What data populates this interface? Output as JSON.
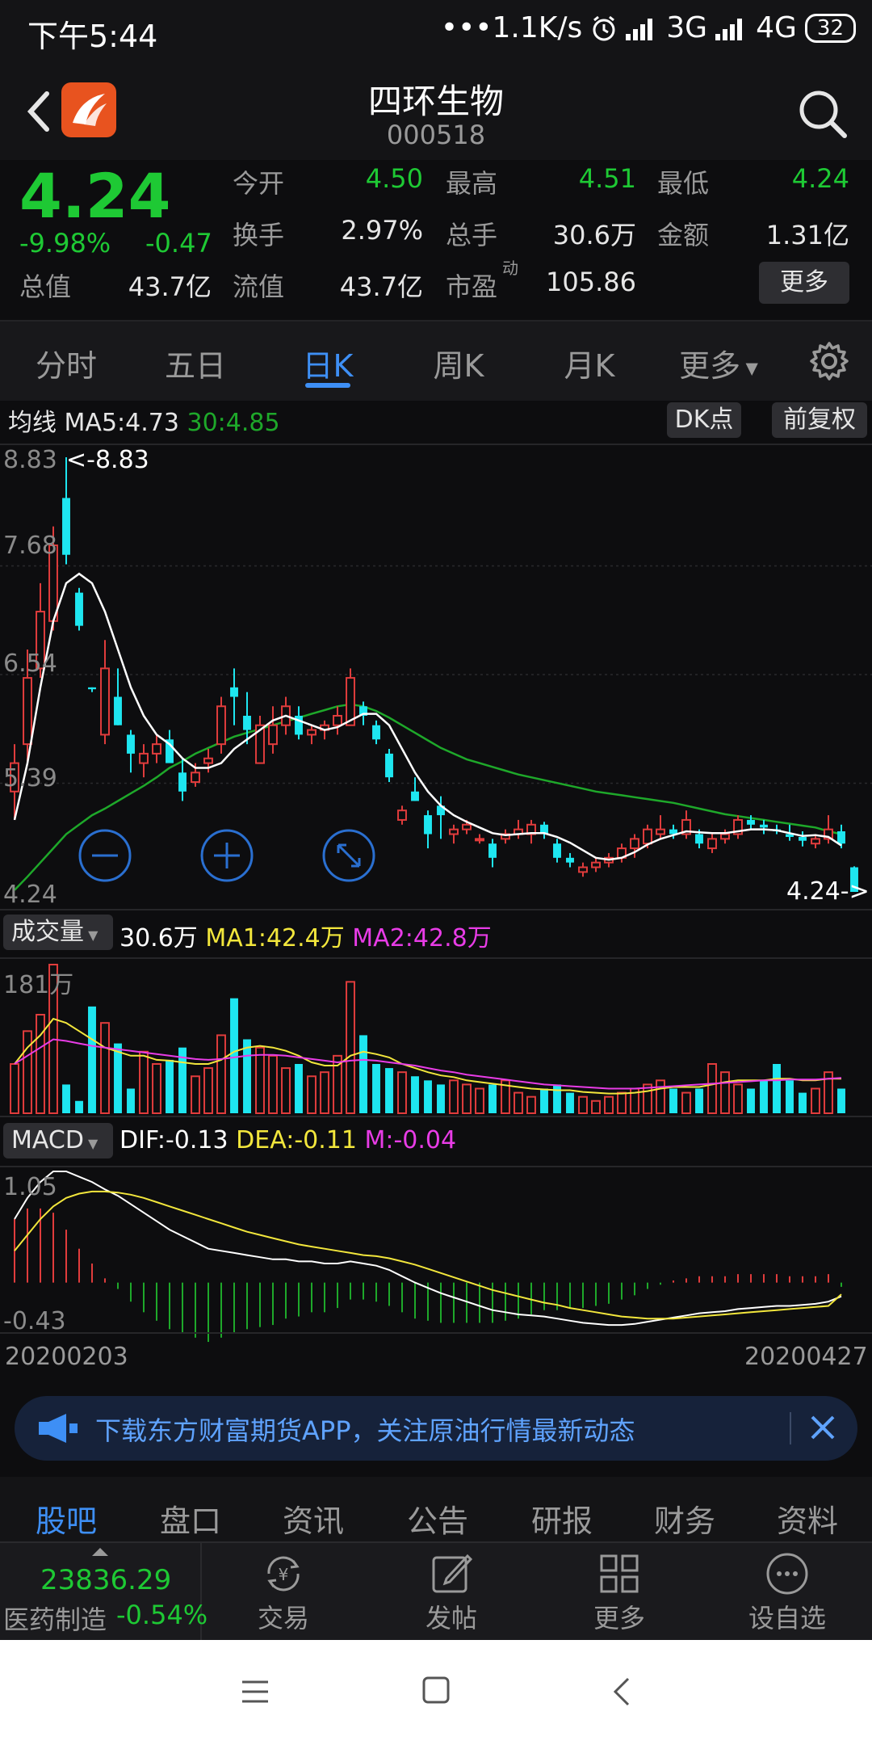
{
  "status": {
    "time": "下午5:44",
    "speed": "•••1.1K/s",
    "net1": "3G",
    "net2": "4G",
    "battery": "32"
  },
  "header": {
    "title": "四环生物",
    "code": "000518"
  },
  "quote": {
    "price": "4.24",
    "pct": "-9.98%",
    "change": "-0.47",
    "rows": [
      [
        {
          "label": "今开",
          "value": "4.50",
          "color": "#1ec934"
        },
        {
          "label": "最高",
          "value": "4.51",
          "color": "#1ec934"
        },
        {
          "label": "最低",
          "value": "4.24",
          "color": "#1ec934"
        }
      ],
      [
        {
          "label": "换手",
          "value": "2.97%",
          "color": "#e6e6e6"
        },
        {
          "label": "总手",
          "value": "30.6万",
          "color": "#e6e6e6"
        },
        {
          "label": "金额",
          "value": "1.31亿",
          "color": "#e6e6e6"
        }
      ]
    ],
    "total_label": "总值",
    "total_value": "43.7亿",
    "float_label": "流值",
    "float_value": "43.7亿",
    "pe_label": "市盈",
    "pe_sup": "动",
    "pe_value": "105.86",
    "more": "更多"
  },
  "tabs": {
    "items": [
      "分时",
      "五日",
      "日K",
      "周K",
      "月K",
      "更多"
    ],
    "active": 2
  },
  "chart": {
    "ma_label": "均线",
    "ma5": "MA5:4.73",
    "ma30": "30:4.85",
    "dk_button": "DK点",
    "adjust_button": "前复权",
    "price_axis": [
      "8.83",
      "7.68",
      "6.54",
      "5.39",
      "4.24"
    ],
    "high_marker": "<-8.83",
    "last_marker": "4.24->",
    "volume_selector": "成交量",
    "volume_value": "30.6万",
    "vol_ma1": "MA1:42.4万",
    "vol_ma2": "MA2:42.8万",
    "volume_max": "181万",
    "macd_selector": "MACD",
    "dif": "DIF:-0.13",
    "dea": "DEA:-0.11",
    "m": "M:-0.04",
    "macd_max": "1.05",
    "macd_min": "-0.43",
    "date_start": "20200203",
    "date_end": "20200427",
    "colors": {
      "up": "#e03c3c",
      "down": "#1ee6f0",
      "ma5": "#ffffff",
      "ma30": "#1ea82a",
      "ma1": "#f2e63c",
      "ma2": "#e83ce6"
    }
  },
  "chart_data": {
    "type": "candlestick",
    "y_range": [
      4.24,
      8.83
    ],
    "candles": [
      {
        "o": 5.3,
        "h": 5.8,
        "l": 5.0,
        "c": 5.6
      },
      {
        "o": 5.8,
        "h": 6.8,
        "l": 5.6,
        "c": 6.5
      },
      {
        "o": 6.6,
        "h": 7.5,
        "l": 6.5,
        "c": 7.2
      },
      {
        "o": 7.1,
        "h": 8.1,
        "l": 7.0,
        "c": 7.9
      },
      {
        "o": 8.4,
        "h": 8.83,
        "l": 7.7,
        "c": 7.8
      },
      {
        "o": 7.4,
        "h": 7.45,
        "l": 7.0,
        "c": 7.05
      },
      {
        "o": 6.4,
        "h": 6.4,
        "l": 6.35,
        "c": 6.38
      },
      {
        "o": 5.9,
        "h": 6.9,
        "l": 5.8,
        "c": 6.6
      },
      {
        "o": 6.3,
        "h": 6.6,
        "l": 6.0,
        "c": 6.0
      },
      {
        "o": 5.9,
        "h": 5.95,
        "l": 5.5,
        "c": 5.7
      },
      {
        "o": 5.6,
        "h": 5.8,
        "l": 5.45,
        "c": 5.7
      },
      {
        "o": 5.7,
        "h": 5.9,
        "l": 5.6,
        "c": 5.8
      },
      {
        "o": 5.85,
        "h": 5.95,
        "l": 5.7,
        "c": 5.6
      },
      {
        "o": 5.5,
        "h": 5.65,
        "l": 5.2,
        "c": 5.3
      },
      {
        "o": 5.4,
        "h": 5.6,
        "l": 5.35,
        "c": 5.5
      },
      {
        "o": 5.6,
        "h": 5.75,
        "l": 5.5,
        "c": 5.65
      },
      {
        "o": 5.8,
        "h": 6.3,
        "l": 5.7,
        "c": 6.2
      },
      {
        "o": 6.4,
        "h": 6.6,
        "l": 6.0,
        "c": 6.3
      },
      {
        "o": 6.1,
        "h": 6.35,
        "l": 5.8,
        "c": 5.95
      },
      {
        "o": 5.6,
        "h": 6.1,
        "l": 5.6,
        "c": 6.0
      },
      {
        "o": 5.8,
        "h": 6.2,
        "l": 5.7,
        "c": 6.0
      },
      {
        "o": 6.0,
        "h": 6.3,
        "l": 5.9,
        "c": 6.2
      },
      {
        "o": 6.1,
        "h": 6.2,
        "l": 5.85,
        "c": 5.9
      },
      {
        "o": 5.9,
        "h": 6.0,
        "l": 5.8,
        "c": 5.95
      },
      {
        "o": 5.95,
        "h": 6.05,
        "l": 5.85,
        "c": 6.0
      },
      {
        "o": 6.0,
        "h": 6.2,
        "l": 5.9,
        "c": 6.1
      },
      {
        "o": 6.0,
        "h": 6.6,
        "l": 6.0,
        "c": 6.5
      },
      {
        "o": 6.2,
        "h": 6.25,
        "l": 6.0,
        "c": 6.1
      },
      {
        "o": 6.0,
        "h": 6.05,
        "l": 5.8,
        "c": 5.85
      },
      {
        "o": 5.7,
        "h": 5.75,
        "l": 5.4,
        "c": 5.45
      },
      {
        "o": 5.0,
        "h": 5.15,
        "l": 4.95,
        "c": 5.1
      },
      {
        "o": 5.3,
        "h": 5.45,
        "l": 5.2,
        "c": 5.2
      },
      {
        "o": 5.05,
        "h": 5.1,
        "l": 4.7,
        "c": 4.85
      },
      {
        "o": 5.15,
        "h": 5.25,
        "l": 4.8,
        "c": 5.05
      },
      {
        "o": 4.85,
        "h": 4.95,
        "l": 4.75,
        "c": 4.9
      },
      {
        "o": 4.9,
        "h": 5.0,
        "l": 4.85,
        "c": 4.95
      },
      {
        "o": 4.8,
        "h": 4.85,
        "l": 4.75,
        "c": 4.8
      },
      {
        "o": 4.75,
        "h": 4.8,
        "l": 4.5,
        "c": 4.6
      },
      {
        "o": 4.8,
        "h": 4.9,
        "l": 4.75,
        "c": 4.85
      },
      {
        "o": 4.85,
        "h": 5.0,
        "l": 4.8,
        "c": 4.9
      },
      {
        "o": 4.85,
        "h": 5.0,
        "l": 4.75,
        "c": 4.95
      },
      {
        "o": 4.95,
        "h": 4.98,
        "l": 4.8,
        "c": 4.85
      },
      {
        "o": 4.75,
        "h": 4.8,
        "l": 4.55,
        "c": 4.6
      },
      {
        "o": 4.6,
        "h": 4.65,
        "l": 4.5,
        "c": 4.55
      },
      {
        "o": 4.45,
        "h": 4.55,
        "l": 4.4,
        "c": 4.5
      },
      {
        "o": 4.5,
        "h": 4.6,
        "l": 4.45,
        "c": 4.55
      },
      {
        "o": 4.55,
        "h": 4.65,
        "l": 4.5,
        "c": 4.6
      },
      {
        "o": 4.6,
        "h": 4.75,
        "l": 4.55,
        "c": 4.7
      },
      {
        "o": 4.7,
        "h": 4.85,
        "l": 4.6,
        "c": 4.8
      },
      {
        "o": 4.75,
        "h": 4.95,
        "l": 4.7,
        "c": 4.9
      },
      {
        "o": 4.85,
        "h": 5.05,
        "l": 4.8,
        "c": 4.9
      },
      {
        "o": 4.9,
        "h": 4.95,
        "l": 4.8,
        "c": 4.85
      },
      {
        "o": 4.85,
        "h": 5.1,
        "l": 4.8,
        "c": 5.0
      },
      {
        "o": 4.85,
        "h": 4.9,
        "l": 4.7,
        "c": 4.75
      },
      {
        "o": 4.7,
        "h": 4.85,
        "l": 4.65,
        "c": 4.8
      },
      {
        "o": 4.8,
        "h": 4.9,
        "l": 4.75,
        "c": 4.85
      },
      {
        "o": 4.85,
        "h": 5.05,
        "l": 4.8,
        "c": 5.0
      },
      {
        "o": 5.0,
        "h": 5.05,
        "l": 4.9,
        "c": 4.95
      },
      {
        "o": 4.95,
        "h": 5.0,
        "l": 4.85,
        "c": 4.92
      },
      {
        "o": 4.9,
        "h": 4.95,
        "l": 4.85,
        "c": 4.88
      },
      {
        "o": 4.85,
        "h": 4.95,
        "l": 4.78,
        "c": 4.82
      },
      {
        "o": 4.82,
        "h": 4.88,
        "l": 4.72,
        "c": 4.78
      },
      {
        "o": 4.75,
        "h": 4.85,
        "l": 4.7,
        "c": 4.8
      },
      {
        "o": 4.8,
        "h": 5.05,
        "l": 4.75,
        "c": 4.9
      },
      {
        "o": 4.88,
        "h": 4.95,
        "l": 4.7,
        "c": 4.75
      },
      {
        "o": 4.5,
        "h": 4.51,
        "l": 4.24,
        "c": 4.24
      }
    ],
    "ma5": [
      5.0,
      5.6,
      6.4,
      7.1,
      7.5,
      7.6,
      7.5,
      7.2,
      6.8,
      6.4,
      6.1,
      5.9,
      5.8,
      5.65,
      5.55,
      5.55,
      5.6,
      5.75,
      5.85,
      5.95,
      6.05,
      6.1,
      6.05,
      6.0,
      5.95,
      5.98,
      6.05,
      6.12,
      6.12,
      6.0,
      5.75,
      5.5,
      5.3,
      5.15,
      5.05,
      4.98,
      4.92,
      4.86,
      4.84,
      4.85,
      4.86,
      4.86,
      4.82,
      4.76,
      4.68,
      4.6,
      4.58,
      4.6,
      4.66,
      4.74,
      4.8,
      4.84,
      4.88,
      4.87,
      4.86,
      4.86,
      4.88,
      4.9,
      4.9,
      4.89,
      4.86,
      4.83,
      4.84,
      4.82,
      4.73
    ],
    "ma30": [
      4.26,
      4.4,
      4.55,
      4.7,
      4.85,
      4.95,
      5.05,
      5.12,
      5.2,
      5.28,
      5.36,
      5.45,
      5.55,
      5.62,
      5.7,
      5.76,
      5.82,
      5.88,
      5.92,
      5.96,
      6.0,
      6.04,
      6.08,
      6.12,
      6.16,
      6.2,
      6.22,
      6.2,
      6.15,
      6.08,
      6.0,
      5.92,
      5.84,
      5.76,
      5.7,
      5.64,
      5.6,
      5.56,
      5.52,
      5.48,
      5.45,
      5.42,
      5.39,
      5.36,
      5.33,
      5.3,
      5.28,
      5.26,
      5.24,
      5.22,
      5.2,
      5.18,
      5.15,
      5.12,
      5.09,
      5.06,
      5.04,
      5.02,
      5.0,
      4.98,
      4.96,
      4.94,
      4.92,
      4.88,
      4.85
    ],
    "volume": [
      60,
      100,
      120,
      181,
      35,
      15,
      130,
      110,
      85,
      30,
      75,
      60,
      65,
      80,
      45,
      55,
      95,
      140,
      90,
      80,
      70,
      55,
      60,
      45,
      50,
      70,
      160,
      95,
      60,
      55,
      50,
      45,
      40,
      35,
      40,
      35,
      30,
      35,
      40,
      25,
      20,
      30,
      35,
      25,
      20,
      15,
      20,
      25,
      30,
      35,
      40,
      30,
      25,
      30,
      60,
      50,
      35,
      30,
      40,
      60,
      40,
      25,
      30,
      50,
      30
    ],
    "vol_ma1": [
      60,
      80,
      95,
      115,
      110,
      100,
      90,
      80,
      75,
      70,
      70,
      65,
      64,
      62,
      60,
      60,
      65,
      75,
      80,
      82,
      80,
      76,
      70,
      62,
      58,
      58,
      70,
      75,
      72,
      68,
      60,
      55,
      50,
      46,
      44,
      40,
      38,
      36,
      34,
      32,
      30,
      29,
      28,
      28,
      26,
      25,
      24,
      24,
      25,
      27,
      30,
      32,
      32,
      32,
      35,
      38,
      40,
      40,
      40,
      42,
      42,
      40,
      40,
      42,
      42
    ],
    "vol_ma2": [
      60,
      70,
      80,
      90,
      88,
      85,
      82,
      80,
      78,
      76,
      74,
      72,
      70,
      68,
      66,
      65,
      66,
      68,
      70,
      71,
      71,
      70,
      68,
      66,
      64,
      62,
      64,
      65,
      64,
      62,
      60,
      58,
      55,
      52,
      50,
      47,
      45,
      43,
      41,
      39,
      37,
      35,
      34,
      33,
      32,
      31,
      30,
      30,
      30,
      31,
      32,
      33,
      34,
      35,
      36,
      37,
      38,
      39,
      40,
      40,
      41,
      41,
      41,
      42,
      43
    ],
    "dif": [
      0.6,
      0.8,
      0.95,
      1.05,
      1.05,
      1.0,
      0.95,
      0.88,
      0.82,
      0.74,
      0.66,
      0.58,
      0.5,
      0.44,
      0.38,
      0.32,
      0.3,
      0.28,
      0.26,
      0.24,
      0.22,
      0.22,
      0.2,
      0.2,
      0.18,
      0.18,
      0.2,
      0.18,
      0.16,
      0.12,
      0.06,
      0.0,
      -0.05,
      -0.1,
      -0.14,
      -0.18,
      -0.22,
      -0.26,
      -0.28,
      -0.3,
      -0.31,
      -0.32,
      -0.34,
      -0.36,
      -0.38,
      -0.39,
      -0.4,
      -0.4,
      -0.39,
      -0.37,
      -0.35,
      -0.33,
      -0.31,
      -0.29,
      -0.28,
      -0.27,
      -0.25,
      -0.24,
      -0.23,
      -0.22,
      -0.22,
      -0.21,
      -0.2,
      -0.18,
      -0.13
    ],
    "dea": [
      0.3,
      0.45,
      0.6,
      0.72,
      0.8,
      0.84,
      0.86,
      0.86,
      0.85,
      0.83,
      0.8,
      0.76,
      0.72,
      0.68,
      0.64,
      0.6,
      0.56,
      0.52,
      0.48,
      0.45,
      0.42,
      0.39,
      0.36,
      0.34,
      0.32,
      0.3,
      0.28,
      0.26,
      0.25,
      0.23,
      0.2,
      0.17,
      0.13,
      0.09,
      0.05,
      0.01,
      -0.03,
      -0.07,
      -0.1,
      -0.13,
      -0.16,
      -0.19,
      -0.21,
      -0.24,
      -0.26,
      -0.28,
      -0.3,
      -0.32,
      -0.33,
      -0.34,
      -0.34,
      -0.34,
      -0.33,
      -0.32,
      -0.31,
      -0.3,
      -0.29,
      -0.28,
      -0.27,
      -0.26,
      -0.25,
      -0.24,
      -0.23,
      -0.22,
      -0.11
    ],
    "macd_range": [
      -0.43,
      1.05
    ]
  },
  "banner": {
    "text": "下载东方财富期货APP，关注原油行情最新动态"
  },
  "bottom_tabs": {
    "items": [
      "股吧",
      "盘口",
      "资讯",
      "公告",
      "研报",
      "财务",
      "资料"
    ],
    "active": 0
  },
  "bottom_bar": {
    "index_value": "23836.29",
    "index_label": "医药制造",
    "index_pct": "-0.54%",
    "buttons": [
      "交易",
      "发帖",
      "更多",
      "设自选"
    ]
  }
}
